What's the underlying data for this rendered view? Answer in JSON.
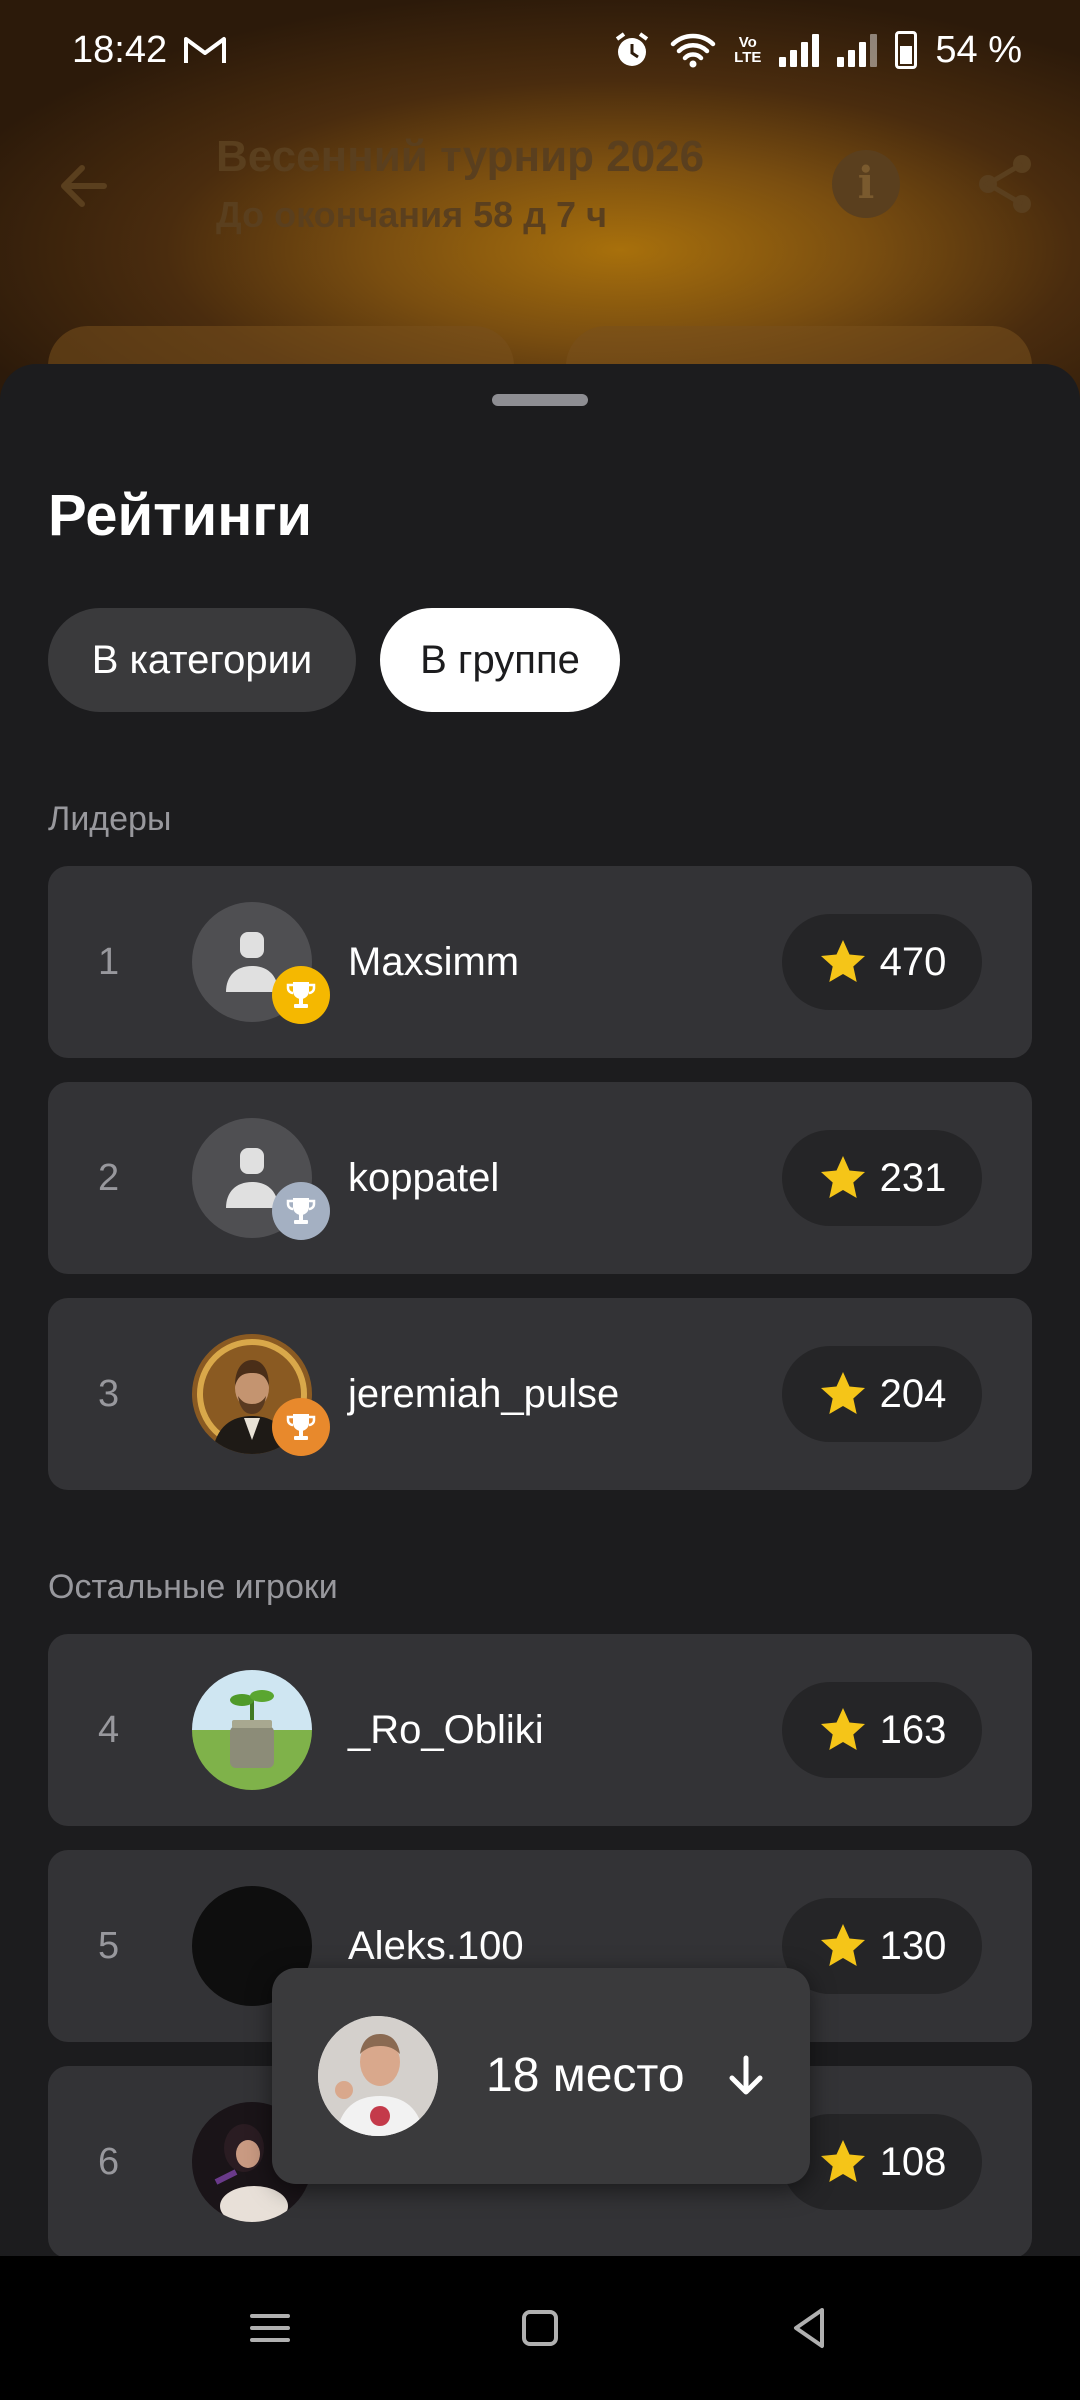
{
  "status_bar": {
    "time": "18:42",
    "battery": "54 %",
    "volte": "Vo LTE",
    "icons": [
      "gmail-icon",
      "alarm-icon",
      "wifi-icon",
      "volte-icon",
      "signal-icon",
      "signal-icon",
      "battery-icon"
    ]
  },
  "app_bar": {
    "title": "Весенний турнир 2026",
    "subtitle": "До окончания 58 д 7 ч",
    "info_glyph": "i"
  },
  "sheet": {
    "title": "Рейтинги",
    "tabs": [
      {
        "label": "В категории",
        "selected": false
      },
      {
        "label": "В группе",
        "selected": true
      }
    ],
    "leaders_label": "Лидеры",
    "others_label": "Остальные игроки",
    "leaders": [
      {
        "rank": "1",
        "name": "Maxsimm",
        "score": "470",
        "trophy": "gold"
      },
      {
        "rank": "2",
        "name": "koppatel",
        "score": "231",
        "trophy": "silver"
      },
      {
        "rank": "3",
        "name": "jeremiah_pulse",
        "score": "204",
        "trophy": "bronze"
      }
    ],
    "others": [
      {
        "rank": "4",
        "name": "_Ro_Obliki",
        "score": "163"
      },
      {
        "rank": "5",
        "name": "Aleks.100",
        "score": "130"
      },
      {
        "rank": "6",
        "name": "",
        "score": "108"
      }
    ]
  },
  "my_place": {
    "label": "18 место"
  },
  "colors": {
    "accent_star": "#f5c518",
    "gold": "#f5b800",
    "silver": "#a4b0c2",
    "bronze": "#e8892c"
  }
}
